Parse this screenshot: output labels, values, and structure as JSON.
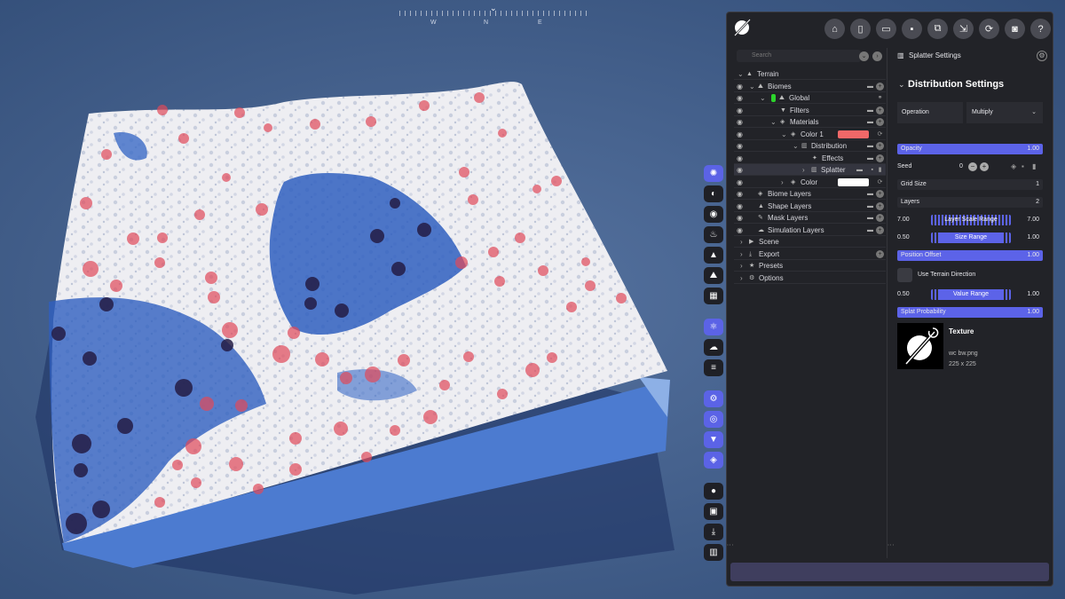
{
  "compass": {
    "w": "W",
    "n": "N",
    "e": "E"
  },
  "colors": {
    "accent": "#5c63e8",
    "panel_bg": "#222328",
    "sky": "#3c5680",
    "color1_swatch": "#f06868",
    "color_swatch": "#ffffff",
    "global_indicator": "#2cd42c"
  },
  "vertical_toolbar": {
    "items": [
      "splatter-icon",
      "color-icon",
      "gradient-icon",
      "fire-icon",
      "mountain-icon",
      "landscape-icon",
      "grid-icon",
      "atom-icon",
      "clouds-icon",
      "layers-lines-icon",
      "settings-cog-icon",
      "eye-icon",
      "filter-icon",
      "stack-icon",
      "record-icon",
      "image-icon",
      "download-icon",
      "chart-icon"
    ]
  },
  "toolbar": {
    "items": [
      "home-icon",
      "new-file-icon",
      "open-folder-icon",
      "save-icon",
      "save-as-icon",
      "export-icon",
      "refresh-icon",
      "camera-icon",
      "help-icon"
    ]
  },
  "tree": {
    "search_placeholder": "Search",
    "rows": [
      {
        "label": "Terrain"
      },
      {
        "label": "Biomes"
      },
      {
        "label": "Global"
      },
      {
        "label": "Filters"
      },
      {
        "label": "Materials"
      },
      {
        "label": "Color 1"
      },
      {
        "label": "Distribution"
      },
      {
        "label": "Effects"
      },
      {
        "label": "Splatter"
      },
      {
        "label": "Color"
      },
      {
        "label": "Biome Layers"
      },
      {
        "label": "Shape Layers"
      },
      {
        "label": "Mask Layers"
      },
      {
        "label": "Simulation Layers"
      },
      {
        "label": "Scene"
      },
      {
        "label": "Export"
      },
      {
        "label": "Presets"
      },
      {
        "label": "Options"
      }
    ]
  },
  "settings": {
    "header": "Splatter Settings",
    "section_title": "Distribution Settings",
    "operation_label": "Operation",
    "operation_value": "Multiply",
    "opacity": {
      "label": "Opacity",
      "value": "1.00",
      "level": 1.0
    },
    "seed": {
      "label": "Seed",
      "value": "0"
    },
    "grid_size": {
      "label": "Grid Size",
      "value": "1"
    },
    "layers": {
      "label": "Layers",
      "value": "2"
    },
    "layer_scale_range": {
      "label": "Layer Scale Range",
      "min": "7.00",
      "max": "7.00"
    },
    "size_range": {
      "label": "Size Range",
      "min": "0.50",
      "max": "1.00"
    },
    "position_offset": {
      "label": "Position Offset",
      "value": "1.00",
      "level": 1.0
    },
    "use_terrain_direction": {
      "label": "Use Terrain Direction"
    },
    "value_range": {
      "label": "Value Range",
      "min": "0.50",
      "max": "1.00"
    },
    "splat_probability": {
      "label": "Splat Probability",
      "value": "1.00",
      "level": 1.0
    },
    "texture": {
      "title": "Texture",
      "filename": "wc bw.png",
      "size": "225 x 225"
    }
  }
}
